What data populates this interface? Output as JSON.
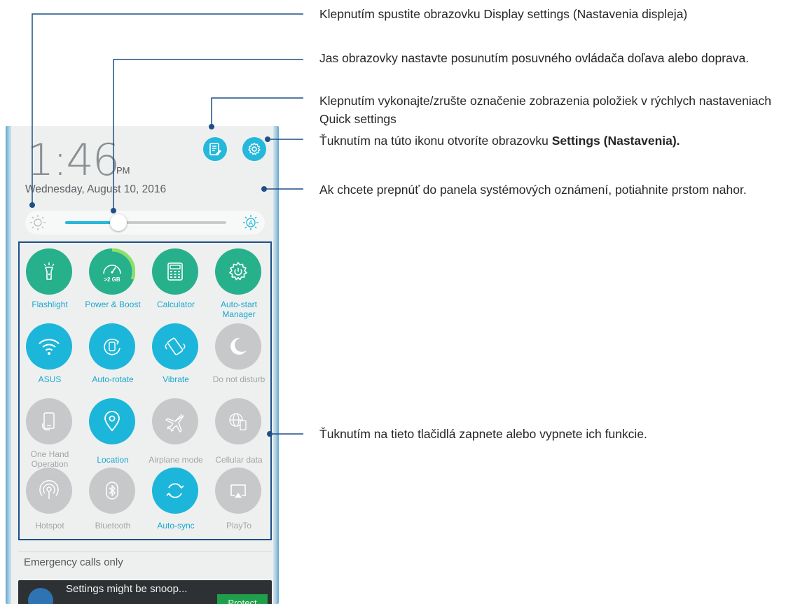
{
  "lock_screen": {
    "time": "1:46",
    "ampm": "PM",
    "date": "Wednesday, August 10, 2016"
  },
  "header_buttons": {
    "edit_icon": "edit-list-icon",
    "settings_icon": "gear-icon"
  },
  "brightness": {
    "level_fraction": 0.33,
    "left_icon": "sun-icon",
    "right_icon": "auto-brightness-icon"
  },
  "quick_settings": {
    "tiles": [
      {
        "label": "Flashlight",
        "icon": "flashlight-icon",
        "state": "green"
      },
      {
        "label": "Power & Boost",
        "icon": "power-boost-icon",
        "state": "green",
        "sub": ">2 GB"
      },
      {
        "label": "Calculator",
        "icon": "calculator-icon",
        "state": "green"
      },
      {
        "label": "Auto-start Manager",
        "icon": "auto-start-gear-icon",
        "state": "green"
      },
      {
        "label": "ASUS",
        "icon": "wifi-icon",
        "state": "on"
      },
      {
        "label": "Auto-rotate",
        "icon": "auto-rotate-icon",
        "state": "on"
      },
      {
        "label": "Vibrate",
        "icon": "vibrate-icon",
        "state": "on"
      },
      {
        "label": "Do not disturb",
        "icon": "moon-icon",
        "state": "off"
      },
      {
        "label": "One Hand Operation",
        "icon": "one-hand-icon",
        "state": "off"
      },
      {
        "label": "Location",
        "icon": "location-pin-icon",
        "state": "on"
      },
      {
        "label": "Airplane mode",
        "icon": "airplane-icon",
        "state": "off"
      },
      {
        "label": "Cellular data",
        "icon": "cellular-globe-icon",
        "state": "off"
      },
      {
        "label": "Hotspot",
        "icon": "hotspot-icon",
        "state": "off"
      },
      {
        "label": "Bluetooth",
        "icon": "bluetooth-icon",
        "state": "off"
      },
      {
        "label": "Auto-sync",
        "icon": "sync-icon",
        "state": "on"
      },
      {
        "label": "PlayTo",
        "icon": "cast-icon",
        "state": "off"
      }
    ]
  },
  "status": {
    "emergency": "Emergency calls only"
  },
  "notification": {
    "text": "Settings might be snoop...",
    "button": "Protect"
  },
  "callouts": {
    "display_settings": "Klepnutím spustite obrazovku Display settings (Nastavenia displeja)",
    "brightness": "Jas obrazovky nastavte posunutím posuvného ovládača doľava alebo doprava.",
    "quick_settings_edit": "Klepnutím vykonajte/zrušte označenie zobrazenia položiek v rýchlych nastaveniach Quick settings",
    "settings_prefix": "Ťuknutím na túto ikonu otvoríte obrazovku ",
    "settings_bold": "Settings (Nastavenia).",
    "notifications": "Ak chcete prepnúť do panela systémových oznámení, potiahnite prstom nahor.",
    "toggles": "Ťuknutím na tieto tlačidlá zapnete alebo vypnete ich funkcie."
  },
  "colors": {
    "accent": "#1cb6da",
    "green": "#27b08c",
    "off": "#c6c8c9",
    "leader": "#1e4f86"
  }
}
